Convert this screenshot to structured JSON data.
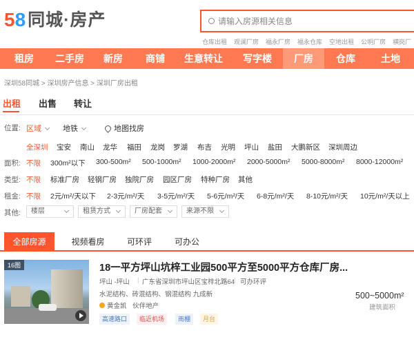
{
  "logo": {
    "digits_5": "5",
    "digits_8": "8",
    "brand": "同城·房产"
  },
  "search": {
    "placeholder": "请输入房源相关信息"
  },
  "hot_links": [
    "仓库出租",
    "观澜厂房",
    "福永厂房",
    "福永仓库",
    "空地出租",
    "公明厂房",
    "横岗厂"
  ],
  "nav": {
    "items": [
      "租房",
      "二手房",
      "新房",
      "商铺",
      "生意转让",
      "写字楼",
      "厂房",
      "仓库",
      "土地"
    ],
    "active": "厂房"
  },
  "breadcrumb": "深圳58同城 > 深圳房产信息 > 深圳厂房出租",
  "deal_tabs": [
    "出租",
    "出售",
    "转让"
  ],
  "location": {
    "label": "位置:",
    "options": [
      "区域",
      "地铁"
    ],
    "map_link": "地图找房"
  },
  "districts": [
    "全深圳",
    "宝安",
    "南山",
    "龙华",
    "福田",
    "龙岗",
    "罗湖",
    "布吉",
    "光明",
    "坪山",
    "盐田",
    "大鹏新区",
    "深圳周边"
  ],
  "area_filter": {
    "label": "面积:",
    "options": [
      "不限",
      "300m²以下",
      "300-500m²",
      "500-1000m²",
      "1000-2000m²",
      "2000-5000m²",
      "5000-8000m²",
      "8000-12000m²"
    ]
  },
  "type_filter": {
    "label": "类型:",
    "options": [
      "不限",
      "标准厂房",
      "轻钢厂房",
      "独院厂房",
      "园区厂房",
      "特种厂房",
      "其他"
    ]
  },
  "rent_filter": {
    "label": "租金:",
    "options": [
      "不限",
      "2元/m²/天以下",
      "2-3元/m²/天",
      "3-5元/m²/天",
      "5-6元/m²/天",
      "6-8元/m²/天",
      "8-10元/m²/天",
      "10元/m²/天以上"
    ]
  },
  "other_filter": {
    "label": "其他:",
    "dropdowns": [
      "楼层",
      "租赁方式",
      "厂房配套",
      "来源不限"
    ]
  },
  "list_tabs": [
    "全部房源",
    "视频看房",
    "可环评",
    "可办公"
  ],
  "listing": {
    "photo_count": "16图",
    "title": "18一平方坪山坑梓工业园500平方至5000平方仓库厂房...",
    "district": "坪山 -坪山",
    "address": "广东省深圳市坪山区宝梓北路64",
    "eia": "可办环评",
    "structure": "水泥结构、砖混结构、钢混结构 九成新",
    "agent": "黄金凯",
    "agent_tag": "伙伴地产",
    "tags": [
      "高速路口",
      "临近机场",
      "雨棚",
      "月台"
    ],
    "area": "500~5000m²",
    "area_label": "建筑面积"
  },
  "colors": {
    "brand_orange": "#ff552e",
    "nav_bg": "#ff7a52",
    "nav_active": "#ff9a78",
    "logo_blue": "#2e9bff"
  },
  "icons": [
    "search-icon",
    "map-pin-icon",
    "video-play-icon",
    "agent-icon"
  ]
}
